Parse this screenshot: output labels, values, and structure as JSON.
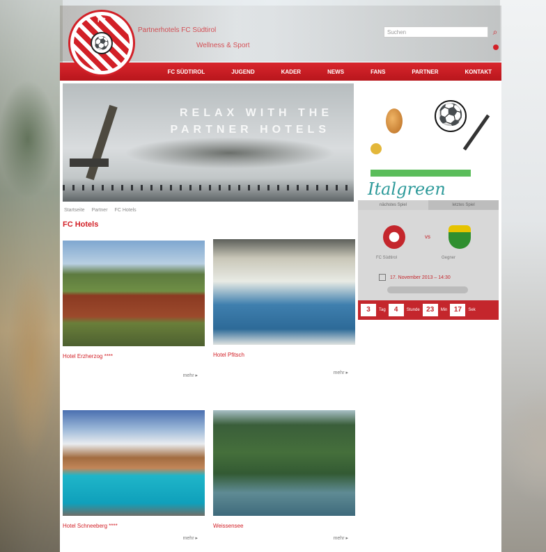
{
  "header": {
    "logo_text": "FC",
    "tagline_1": "Partnerhotels FC Südtirol",
    "tagline_2": "Wellness & Sport",
    "search_placeholder": "Suchen"
  },
  "nav": {
    "items": [
      "FC SÜDTIROL",
      "JUGEND",
      "KADER",
      "NEWS",
      "FANS",
      "PARTNER",
      "KONTAKT"
    ]
  },
  "hero": {
    "line_1": "RELAX WITH THE",
    "line_2": "PARTNER HOTELS"
  },
  "breadcrumb": [
    "Startseite",
    "Partner",
    "FC Hotels"
  ],
  "section_title": "FC Hotels",
  "cards": [
    {
      "title": "Hotel Erzherzog ****",
      "more": "mehr ▸"
    },
    {
      "title": "Hotel Pfitsch",
      "more": "mehr ▸"
    },
    {
      "title": "Hotel Schneeberg ****",
      "more": "mehr ▸"
    },
    {
      "title": "Weissensee",
      "more": "mehr ▸"
    }
  ],
  "sponsor": {
    "name": "Italgreen"
  },
  "match": {
    "tabs": [
      "nächstes Spiel",
      "letztes Spiel"
    ],
    "home": "FC Südtirol",
    "away": "Gegner",
    "vs": "vs",
    "date": "17. November 2013 – 14:30"
  },
  "countdown": [
    {
      "num": "3",
      "unit": "Tag"
    },
    {
      "num": "4",
      "unit": "Stunde"
    },
    {
      "num": "23",
      "unit": "Min"
    },
    {
      "num": "17",
      "unit": "Sek"
    }
  ]
}
